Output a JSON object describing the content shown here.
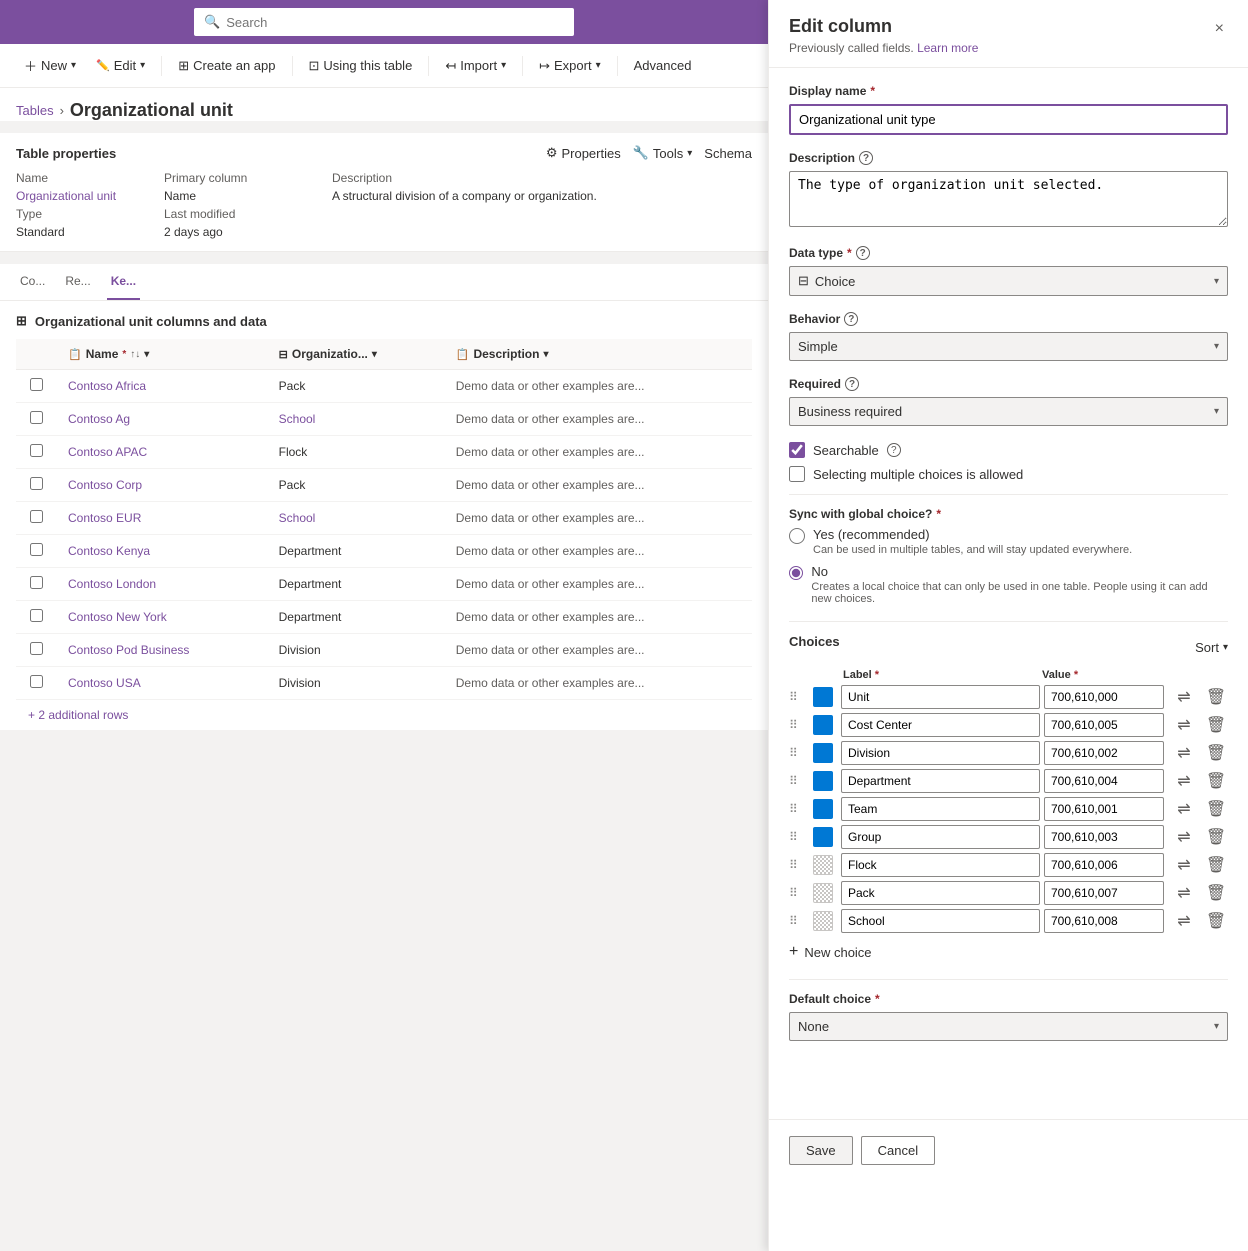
{
  "topBar": {
    "searchPlaceholder": "Search"
  },
  "commandBar": {
    "new": "New",
    "edit": "Edit",
    "createApp": "Create an app",
    "usingThisTable": "Using this table",
    "import": "Import",
    "export": "Export",
    "advanced": "Advanced"
  },
  "breadcrumb": {
    "parent": "Tables",
    "current": "Organizational unit"
  },
  "tableProperties": {
    "title": "Table properties",
    "actions": {
      "properties": "Properties",
      "tools": "Tools",
      "schema": "Schema"
    },
    "name": {
      "label": "Name",
      "value": "Organizational unit"
    },
    "primaryColumn": {
      "label": "Primary column",
      "value": "Name"
    },
    "description": {
      "label": "Description",
      "value": "A structural division of a company or organization."
    },
    "type": {
      "label": "Type",
      "value": "Standard"
    },
    "lastModified": {
      "label": "Last modified",
      "value": "2 days ago"
    }
  },
  "dataSection": {
    "title": "Organizational unit columns and data",
    "columns": {
      "name": "Name",
      "orgType": "Organizatio...",
      "description": "Description"
    },
    "rows": [
      {
        "name": "Contoso Africa",
        "type": "Pack",
        "description": "Demo data or other examples are..."
      },
      {
        "name": "Contoso Ag",
        "type": "School",
        "description": "Demo data or other examples are...",
        "typeLink": true
      },
      {
        "name": "Contoso APAC",
        "type": "Flock",
        "description": "Demo data or other examples are..."
      },
      {
        "name": "Contoso Corp",
        "type": "Pack",
        "description": "Demo data or other examples are..."
      },
      {
        "name": "Contoso EUR",
        "type": "School",
        "description": "Demo data or other examples are...",
        "typeLink": true
      },
      {
        "name": "Contoso Kenya",
        "type": "Department",
        "description": "Demo data or other examples are..."
      },
      {
        "name": "Contoso London",
        "type": "Department",
        "description": "Demo data or other examples are..."
      },
      {
        "name": "Contoso New York",
        "type": "Department",
        "description": "Demo data or other examples are..."
      },
      {
        "name": "Contoso Pod Business",
        "type": "Division",
        "description": "Demo data or other examples are..."
      },
      {
        "name": "Contoso USA",
        "type": "Division",
        "description": "Demo data or other examples are..."
      }
    ],
    "moreRows": "+ 2 additional rows"
  },
  "editPanel": {
    "title": "Edit column",
    "subtitle": "Previously called fields.",
    "learnMore": "Learn more",
    "closeLabel": "×",
    "displayName": {
      "label": "Display name",
      "required": true,
      "value": "Organizational unit type"
    },
    "description": {
      "label": "Description",
      "infoIcon": "?",
      "value": "The type of organization unit selected."
    },
    "dataType": {
      "label": "Data type",
      "required": true,
      "infoIcon": "?",
      "value": "Choice",
      "icon": "⊟"
    },
    "behavior": {
      "label": "Behavior",
      "infoIcon": "?",
      "value": "Simple"
    },
    "required": {
      "label": "Required",
      "infoIcon": "?",
      "value": "Business required"
    },
    "searchable": {
      "label": "Searchable",
      "infoIcon": "?",
      "checked": true
    },
    "multipleChoices": {
      "label": "Selecting multiple choices is allowed",
      "checked": false
    },
    "syncGlobal": {
      "label": "Sync with global choice?",
      "required": true,
      "options": [
        {
          "id": "yes",
          "label": "Yes (recommended)",
          "desc": "Can be used in multiple tables, and will stay updated everywhere.",
          "selected": false
        },
        {
          "id": "no",
          "label": "No",
          "desc": "Creates a local choice that can only be used in one table. People using it can add new choices.",
          "selected": true
        }
      ]
    },
    "choices": {
      "sectionLabel": "Choices",
      "sortLabel": "Sort",
      "labelHeader": "Label",
      "valueHeader": "Value",
      "items": [
        {
          "label": "Unit",
          "value": "700,610,000",
          "colorType": "blue",
          "enabled": true
        },
        {
          "label": "Cost Center",
          "value": "700,610,005",
          "colorType": "blue",
          "enabled": true
        },
        {
          "label": "Division",
          "value": "700,610,002",
          "colorType": "blue",
          "enabled": true
        },
        {
          "label": "Department",
          "value": "700,610,004",
          "colorType": "blue",
          "enabled": true
        },
        {
          "label": "Team",
          "value": "700,610,001",
          "colorType": "blue",
          "enabled": true
        },
        {
          "label": "Group",
          "value": "700,610,003",
          "colorType": "blue",
          "enabled": true
        },
        {
          "label": "Flock",
          "value": "700,610,006",
          "colorType": "disabled",
          "enabled": false
        },
        {
          "label": "Pack",
          "value": "700,610,007",
          "colorType": "disabled",
          "enabled": false
        },
        {
          "label": "School",
          "value": "700,610,008",
          "colorType": "disabled",
          "enabled": false
        }
      ],
      "addLabel": "New choice"
    },
    "defaultChoice": {
      "label": "Default choice",
      "required": true,
      "value": "None"
    },
    "footer": {
      "saveLabel": "Save",
      "cancelLabel": "Cancel"
    }
  },
  "colors": {
    "accent": "#7B4F9E",
    "accentBlue": "#0078d4"
  }
}
